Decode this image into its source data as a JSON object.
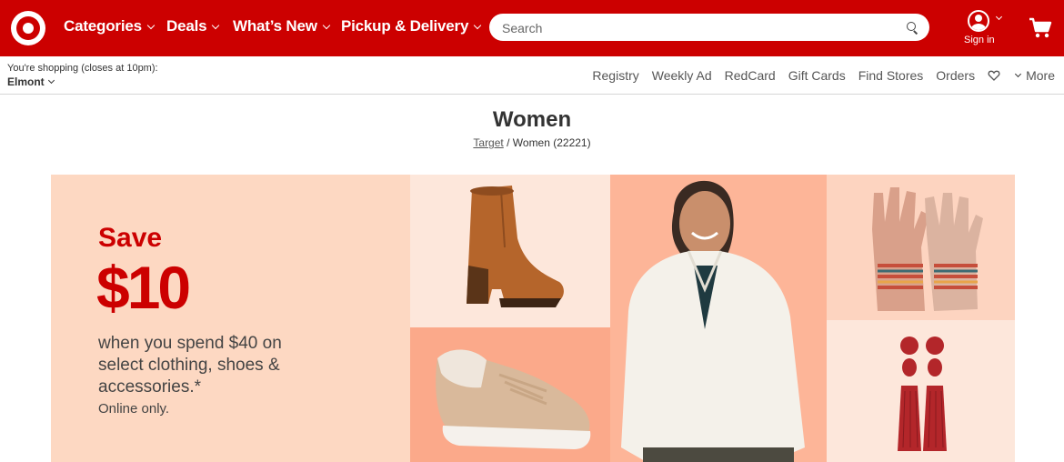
{
  "header": {
    "logo_name": "target-bullseye-logo",
    "nav": [
      {
        "label": "Categories",
        "has_dropdown": true
      },
      {
        "label": "Deals",
        "has_dropdown": true
      },
      {
        "label": "What’s New",
        "has_dropdown": true
      },
      {
        "label": "Pickup & Delivery",
        "has_dropdown": true
      }
    ],
    "search": {
      "placeholder": "Search",
      "value": ""
    },
    "signin_label": "Sign in",
    "brand_color": "#cc0000"
  },
  "utility": {
    "store_label": "You're shopping (closes at 10pm):",
    "store_name": "Elmont",
    "links": [
      "Registry",
      "Weekly Ad",
      "RedCard",
      "Gift Cards",
      "Find Stores",
      "Orders"
    ],
    "more_label": "More"
  },
  "page": {
    "title": "Women",
    "breadcrumb": {
      "home": "Target",
      "separator": "/",
      "current": "Women (22221)"
    }
  },
  "hero": {
    "save": "Save",
    "amount": "$10",
    "offer": "when you spend $40 on select clothing, shoes & accessories.*",
    "online": "Online only.",
    "tiles": [
      "boot-image",
      "sneaker-image",
      "model-fleece-image",
      "gloves-image",
      "earrings-image"
    ]
  }
}
